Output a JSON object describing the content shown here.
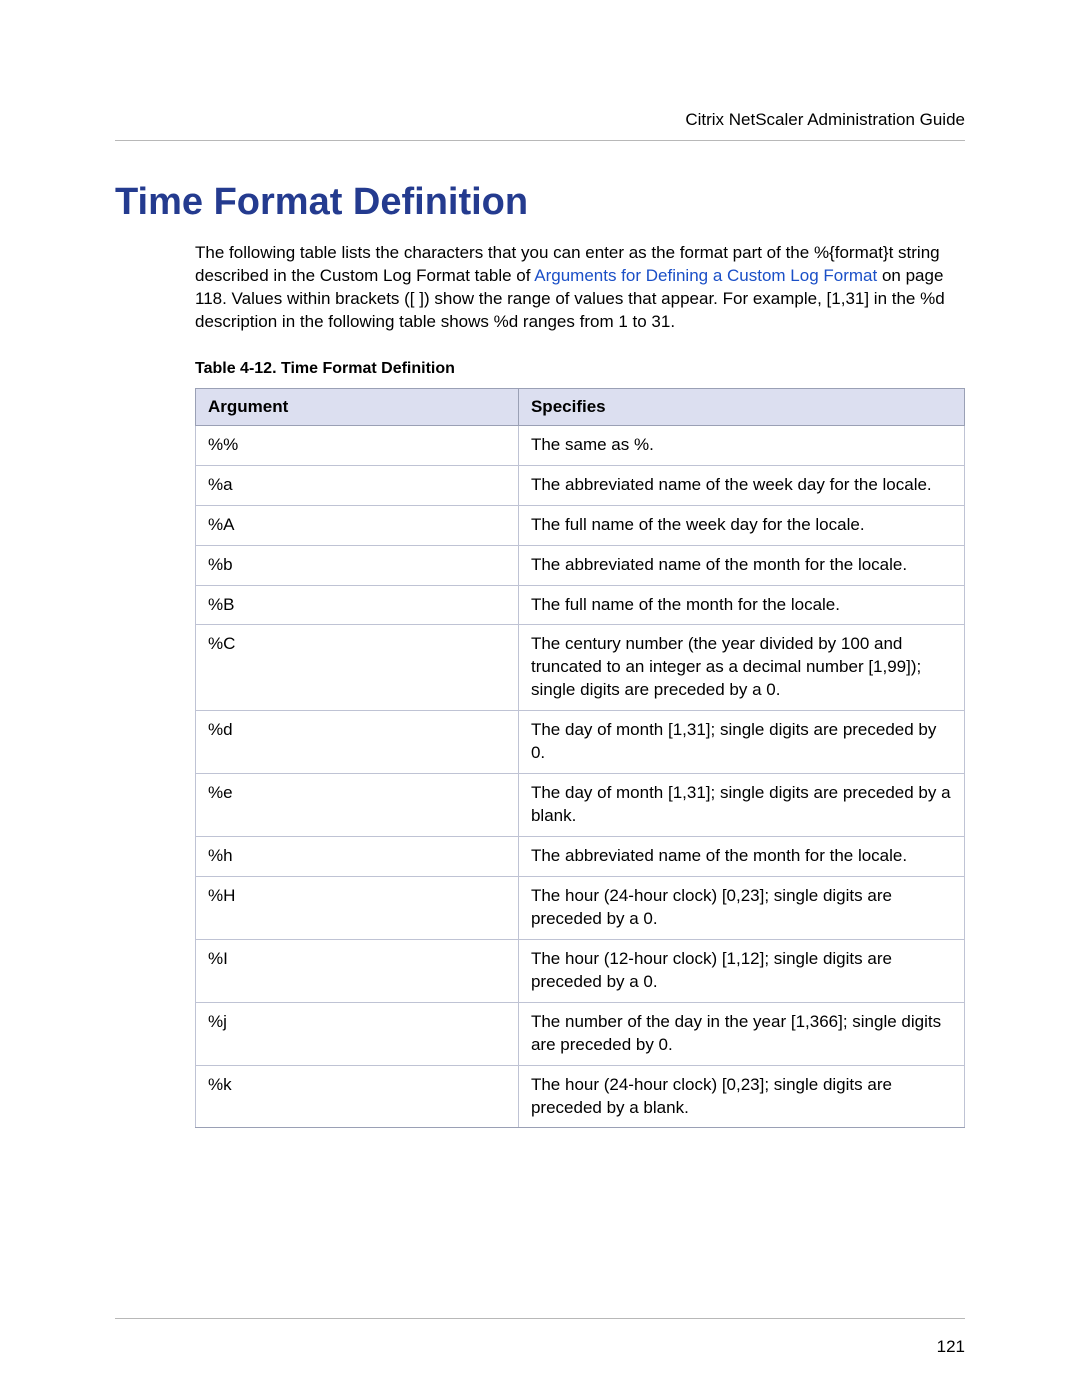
{
  "header": {
    "running_title": "Citrix NetScaler Administration Guide"
  },
  "title": "Time Format Definition",
  "intro": {
    "text_before_link": "The following table lists the characters that you can enter as the format part of the %{format}t string described in the Custom Log Format table of ",
    "link_text": "Arguments for Defining a Custom Log Format",
    "text_after_link": " on page 118. Values within brackets ([ ]) show the range of values that appear. For example, [1,31] in the %d description in the following table shows %d ranges from 1 to 31."
  },
  "table": {
    "caption": "Table 4-12. Time Format Definition",
    "columns": {
      "argument": "Argument",
      "specifies": "Specifies"
    },
    "rows": [
      {
        "arg": "%%",
        "spec": "The same as %."
      },
      {
        "arg": "%a",
        "spec": "The abbreviated name of the week day for the locale."
      },
      {
        "arg": "%A",
        "spec": "The full name of the week day for the locale."
      },
      {
        "arg": "%b",
        "spec": "The abbreviated name of the month for the locale."
      },
      {
        "arg": "%B",
        "spec": "The full name of the month for the locale."
      },
      {
        "arg": "%C",
        "spec": "The century number (the year divided by 100 and truncated to an integer as a decimal number [1,99]); single digits are preceded by a 0."
      },
      {
        "arg": "%d",
        "spec": "The day of month [1,31]; single digits are preceded by 0."
      },
      {
        "arg": "%e",
        "spec": "The day of month [1,31]; single digits are preceded by a blank."
      },
      {
        "arg": "%h",
        "spec": "The abbreviated name of the month for the locale."
      },
      {
        "arg": "%H",
        "spec": "The hour (24-hour clock) [0,23]; single digits are preceded by a 0."
      },
      {
        "arg": "%I",
        "spec": "The hour (12-hour clock) [1,12]; single digits are preceded by a 0."
      },
      {
        "arg": "%j",
        "spec": "The number of the day in the year [1,366]; single digits are preceded by 0."
      },
      {
        "arg": "%k",
        "spec": "The hour (24-hour clock) [0,23]; single digits are preceded by a blank."
      }
    ]
  },
  "footer": {
    "page_number": "121"
  }
}
